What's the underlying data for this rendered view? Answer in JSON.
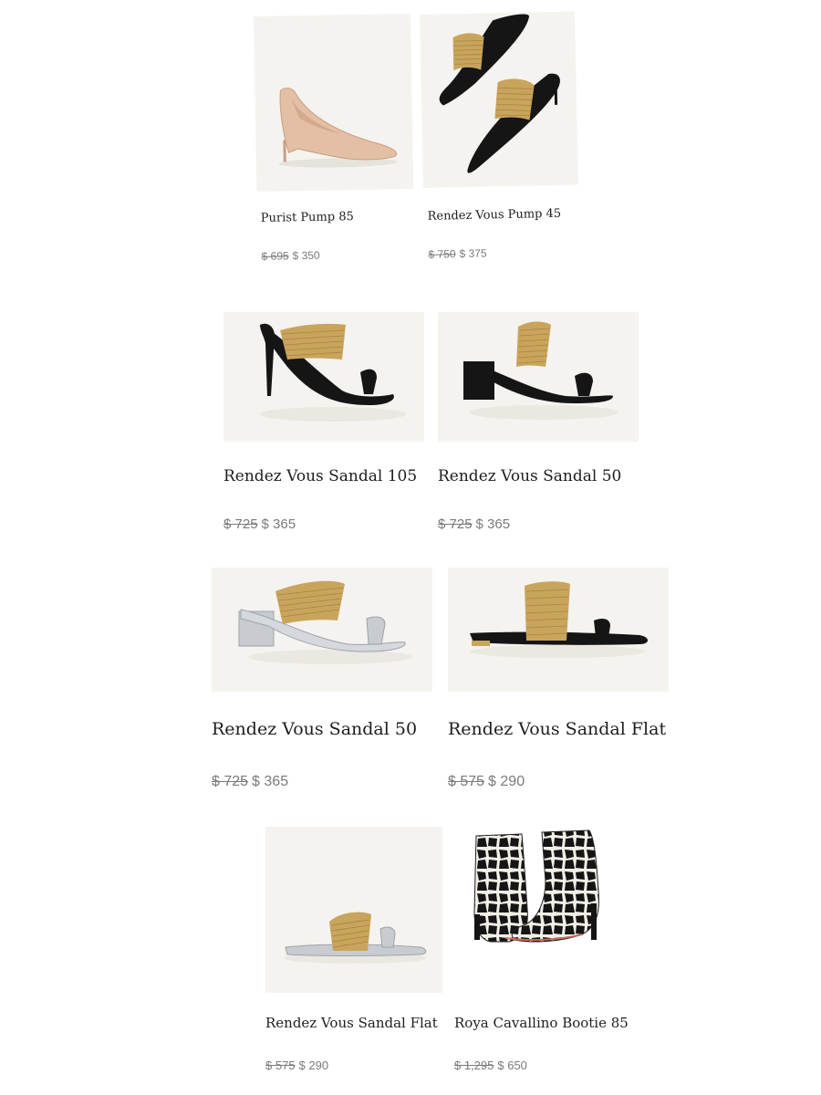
{
  "products": [
    {
      "name": "Purist Pump 85",
      "old_price": "$ 695",
      "price": "$ 350"
    },
    {
      "name": "Rendez Vous Pump 45",
      "old_price": "$ 750",
      "price": "$ 375"
    },
    {
      "name": "Rendez Vous Sandal 105",
      "old_price": "$ 725",
      "price": "$ 365"
    },
    {
      "name": "Rendez Vous Sandal 50",
      "old_price": "$ 725",
      "price": "$ 365"
    },
    {
      "name": "Rendez Vous Sandal 50",
      "old_price": "$ 725",
      "price": "$ 365"
    },
    {
      "name": "Rendez Vous Sandal Flat",
      "old_price": "$ 575",
      "price": "$ 290"
    },
    {
      "name": "Rendez Vous Sandal Flat",
      "old_price": "$ 575",
      "price": "$ 290"
    },
    {
      "name": "Roya Cavallino Bootie 85",
      "old_price": "$ 1,295",
      "price": "$ 650"
    }
  ],
  "colors": {
    "image_background": "#f5f3ef",
    "gold": "#c9a45c",
    "black": "#151515",
    "nude": "#e3bfa5",
    "silver": "#c8ccd0",
    "price_gray": "#7a7a7a"
  }
}
